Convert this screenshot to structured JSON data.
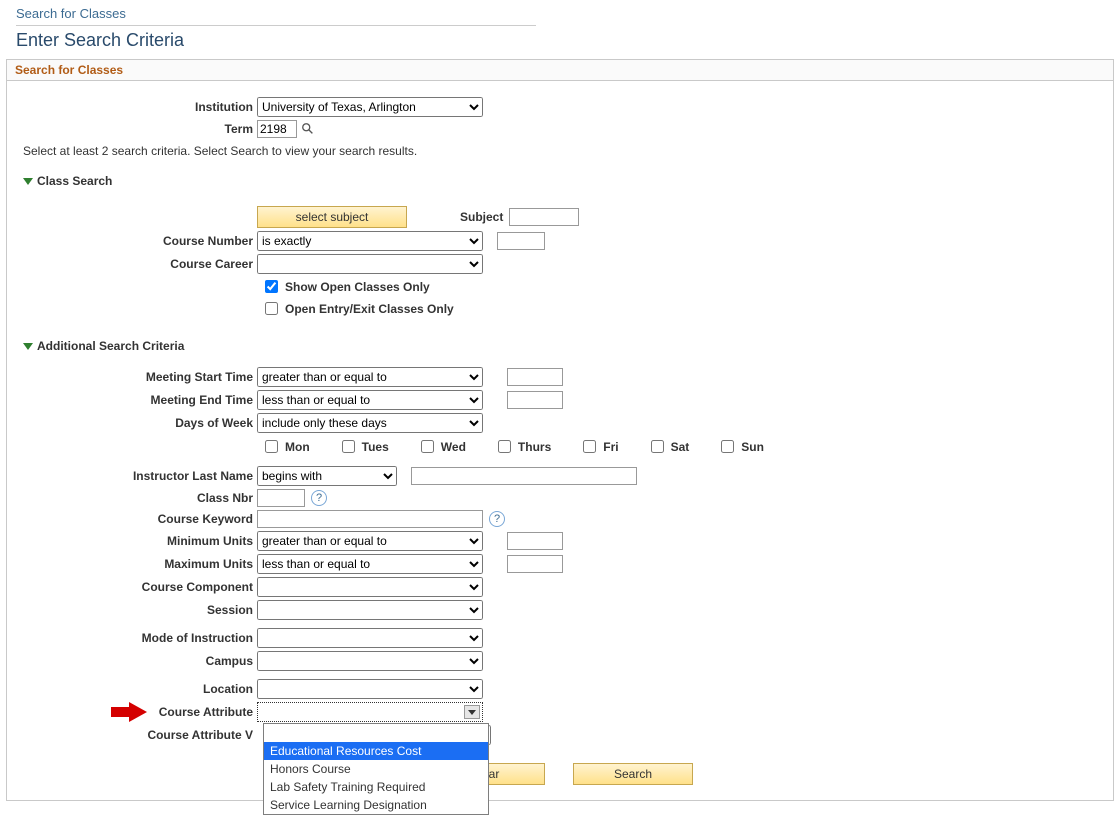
{
  "header": {
    "top_title": "Search for Classes",
    "page_title": "Enter Search Criteria",
    "section": "Search for Classes"
  },
  "form_top": {
    "institution_label": "Institution",
    "institution_value": "University of Texas, Arlington",
    "term_label": "Term",
    "term_value": "2198"
  },
  "instruction": "Select at least 2 search criteria. Select Search to view your search results.",
  "class_search": {
    "title": "Class Search",
    "select_subject_btn": "select subject",
    "subject_label": "Subject",
    "course_number_label": "Course Number",
    "course_number_op": "is exactly",
    "course_career_label": "Course Career",
    "show_open_label": "Show Open Classes Only",
    "open_entry_label": "Open Entry/Exit Classes Only"
  },
  "additional": {
    "title": "Additional Search Criteria",
    "meeting_start_label": "Meeting Start Time",
    "meeting_start_op": "greater than or equal to",
    "meeting_end_label": "Meeting End Time",
    "meeting_end_op": "less than or equal to",
    "days_label": "Days of Week",
    "days_op": "include only these days",
    "days": {
      "mon": "Mon",
      "tue": "Tues",
      "wed": "Wed",
      "thu": "Thurs",
      "fri": "Fri",
      "sat": "Sat",
      "sun": "Sun"
    },
    "instr_last_label": "Instructor Last Name",
    "instr_last_op": "begins with",
    "class_nbr_label": "Class Nbr",
    "course_keyword_label": "Course Keyword",
    "min_units_label": "Minimum Units",
    "min_units_op": "greater than or equal to",
    "max_units_label": "Maximum Units",
    "max_units_op": "less than or equal to",
    "course_component_label": "Course Component",
    "session_label": "Session",
    "mode_label": "Mode of Instruction",
    "campus_label": "Campus",
    "location_label": "Location",
    "course_attr_label": "Course Attribute",
    "course_attr_val_label": "Course Attribute V",
    "attribute_options": {
      "o1": "Educational Resources Cost",
      "o2": "Honors Course",
      "o3": "Lab Safety Training Required",
      "o4": "Service Learning Designation"
    }
  },
  "buttons": {
    "clear": "Clear",
    "search": "Search"
  }
}
